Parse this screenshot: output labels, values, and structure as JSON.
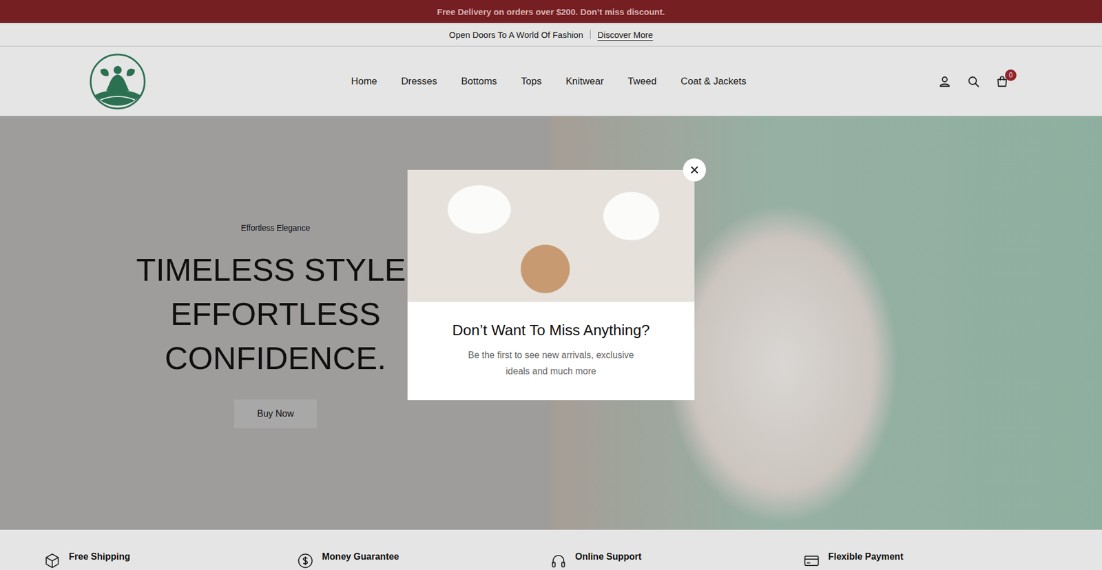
{
  "announcement": "Free Delivery on orders over $200. Don’t miss discount.",
  "promo_bar": {
    "text": "Open Doors To A World Of Fashion",
    "link": "Discover More"
  },
  "nav": [
    "Home",
    "Dresses",
    "Bottoms",
    "Tops",
    "Knitwear",
    "Tweed",
    "Coat & Jackets"
  ],
  "cart": {
    "count": "0"
  },
  "hero": {
    "eyebrow": "Effortless Elegance",
    "headline": [
      "TIMELESS STYLE,",
      "EFFORTLESS",
      "CONFIDENCE."
    ],
    "button": "Buy Now"
  },
  "features": [
    {
      "title": "Free Shipping",
      "kind": "box"
    },
    {
      "title": "Money Guarantee",
      "kind": "dollar"
    },
    {
      "title": "Online Support",
      "kind": "headset"
    },
    {
      "title": "Flexible Payment",
      "kind": "card"
    }
  ],
  "popup": {
    "title": "Don’t Want To Miss Anything?",
    "description": "Be the first to see new arrivals, exclusive ideals and much more"
  }
}
